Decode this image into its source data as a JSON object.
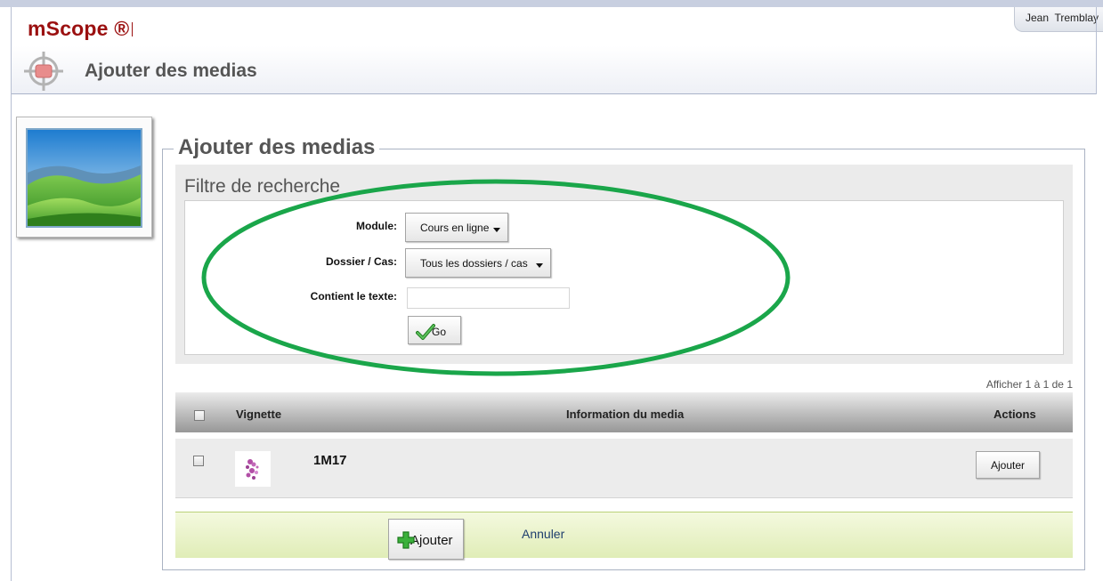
{
  "app": {
    "brand": "mScope ®",
    "user_name": "Jean  Tremblay",
    "page_header_title": "Ajouter des medias"
  },
  "form": {
    "legend": "Ajouter des medias",
    "filter": {
      "title": "Filtre de recherche",
      "module_label": "Module:",
      "module_value": "Cours en ligne",
      "dossier_label": "Dossier / Cas:",
      "dossier_value": "Tous les dossiers / cas",
      "text_label": "Contient le texte:",
      "text_value": "",
      "go_label": "Go"
    }
  },
  "results": {
    "pager_text": "Afficher 1 à 1 de 1",
    "columns": [
      "Vignette",
      "Information du media",
      "Actions"
    ],
    "rows": [
      {
        "name": "1M17",
        "action_label": "Ajouter",
        "checked": false
      }
    ]
  },
  "footer": {
    "add_label": "Ajouter",
    "cancel_label": "Annuler"
  },
  "colors": {
    "brand": "#9b1010",
    "annotation_oval": "#1aa64a",
    "footer_bar": "#e0edb7",
    "link": "#1f3f6e"
  },
  "icons": [
    "target-icon",
    "landscape-photo-icon",
    "checkmark-icon",
    "plus-icon",
    "dropdown-caret-icon"
  ]
}
